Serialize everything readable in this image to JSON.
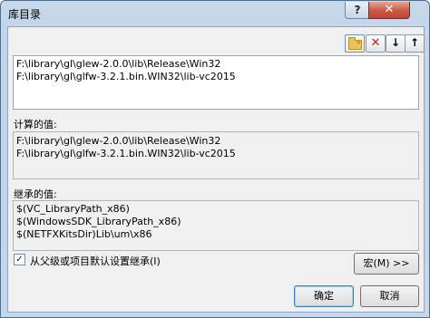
{
  "window": {
    "title": "库目录",
    "help_label": "?",
    "close_label": "✕"
  },
  "toolbar": {
    "new_folder_icon": "new-folder-icon",
    "delete_icon": "delete-icon",
    "delete_label": "✕",
    "move_down_label": "↓",
    "move_up_label": "↑"
  },
  "edit_list": {
    "lines": [
      "F:\\library\\gl\\glew-2.0.0\\lib\\Release\\Win32",
      "F:\\library\\gl\\glfw-3.2.1.bin.WIN32\\lib-vc2015"
    ]
  },
  "evaluated": {
    "label": "计算的值:",
    "lines": [
      "F:\\library\\gl\\glew-2.0.0\\lib\\Release\\Win32",
      "F:\\library\\gl\\glfw-3.2.1.bin.WIN32\\lib-vc2015"
    ]
  },
  "inherited": {
    "label": "继承的值:",
    "lines": [
      "$(VC_LibraryPath_x86)",
      "$(WindowsSDK_LibraryPath_x86)",
      "$(NETFXKitsDir)Lib\\um\\x86"
    ]
  },
  "inherit_checkbox": {
    "checked": true,
    "check_mark": "✓",
    "label": "从父级或项目默认设置继承(I)"
  },
  "buttons": {
    "macros": "宏(M) >>",
    "ok": "确定",
    "cancel": "取消"
  }
}
